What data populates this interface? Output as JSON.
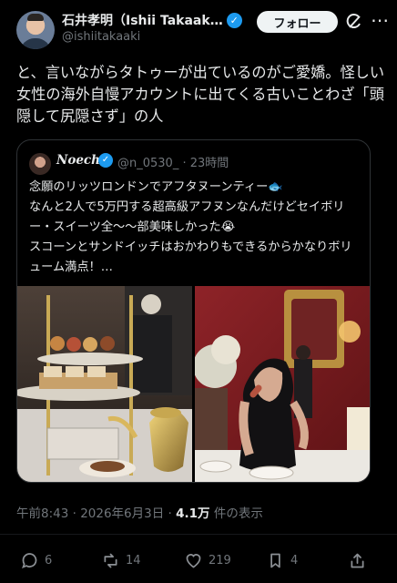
{
  "header": {
    "display_name": "石井孝明（Ishii Takaak…",
    "handle": "@ishiitakaaki",
    "follow_label": "フォロー"
  },
  "post": {
    "text": "と、言いながらタトゥーが出ているのがご愛嬌。怪しい女性の海外自慢アカウントに出てくる古いことわざ「頭隠して尻隠さず」の人"
  },
  "quote": {
    "display_name": "Noechi",
    "handle": "@n_0530_ · 23時間",
    "text": "念願のリッツロンドンでアフタヌーンティー🐟\nなんと2人で5万円する超高級アフヌンなんだけどセイボリー・スイーツ全〜〜部美味しかった😭\nスコーンとサンドイッチはおかわりもできるからかなりボリューム満点！…"
  },
  "meta": {
    "timestamp": "午前8:43 · 2026年6月3日 · ",
    "views_count": "4.1万",
    "views_label": " 件の表示"
  },
  "actions": {
    "replies": "6",
    "reposts": "14",
    "likes": "219",
    "bookmarks": "4"
  },
  "colors": {
    "background": "#000000",
    "text": "#e7e9ea",
    "secondary_text": "#71767b",
    "verified": "#1d9bf0",
    "follow_button": "#eff3f4"
  },
  "icons": {
    "verified": "verified-badge-icon",
    "grok": "grok-icon",
    "more": "more-options-icon",
    "reply": "reply-icon",
    "repost": "repost-icon",
    "like": "like-icon",
    "bookmark": "bookmark-icon",
    "share": "share-icon"
  }
}
